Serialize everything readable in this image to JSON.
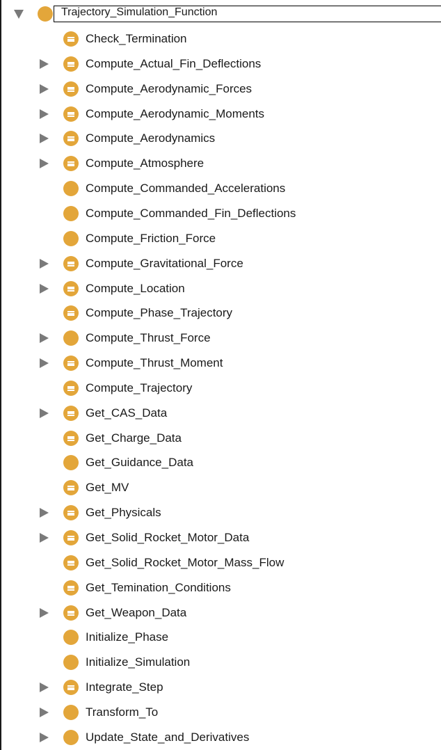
{
  "root": {
    "label": "Trajectory_Simulation_Function",
    "expanded": true,
    "icon": "class-circle-icon"
  },
  "items": [
    {
      "label": "Check_Termination",
      "expandable": false,
      "icon": "lines"
    },
    {
      "label": "Compute_Actual_Fin_Deflections",
      "expandable": true,
      "icon": "lines"
    },
    {
      "label": "Compute_Aerodynamic_Forces",
      "expandable": true,
      "icon": "lines"
    },
    {
      "label": "Compute_Aerodynamic_Moments",
      "expandable": true,
      "icon": "lines"
    },
    {
      "label": "Compute_Aerodynamics",
      "expandable": true,
      "icon": "lines"
    },
    {
      "label": "Compute_Atmosphere",
      "expandable": true,
      "icon": "lines"
    },
    {
      "label": "Compute_Commanded_Accelerations",
      "expandable": false,
      "icon": "plain"
    },
    {
      "label": "Compute_Commanded_Fin_Deflections",
      "expandable": false,
      "icon": "plain"
    },
    {
      "label": "Compute_Friction_Force",
      "expandable": false,
      "icon": "plain"
    },
    {
      "label": "Compute_Gravitational_Force",
      "expandable": true,
      "icon": "lines"
    },
    {
      "label": "Compute_Location",
      "expandable": true,
      "icon": "lines"
    },
    {
      "label": "Compute_Phase_Trajectory",
      "expandable": false,
      "icon": "lines"
    },
    {
      "label": "Compute_Thrust_Force",
      "expandable": true,
      "icon": "plain"
    },
    {
      "label": "Compute_Thrust_Moment",
      "expandable": true,
      "icon": "lines"
    },
    {
      "label": "Compute_Trajectory",
      "expandable": false,
      "icon": "lines"
    },
    {
      "label": "Get_CAS_Data",
      "expandable": true,
      "icon": "lines"
    },
    {
      "label": "Get_Charge_Data",
      "expandable": false,
      "icon": "lines"
    },
    {
      "label": "Get_Guidance_Data",
      "expandable": false,
      "icon": "plain"
    },
    {
      "label": "Get_MV",
      "expandable": false,
      "icon": "lines"
    },
    {
      "label": "Get_Physicals",
      "expandable": true,
      "icon": "lines"
    },
    {
      "label": "Get_Solid_Rocket_Motor_Data",
      "expandable": true,
      "icon": "lines"
    },
    {
      "label": "Get_Solid_Rocket_Motor_Mass_Flow",
      "expandable": false,
      "icon": "lines"
    },
    {
      "label": "Get_Temination_Conditions",
      "expandable": false,
      "icon": "lines"
    },
    {
      "label": "Get_Weapon_Data",
      "expandable": true,
      "icon": "lines"
    },
    {
      "label": "Initialize_Phase",
      "expandable": false,
      "icon": "plain"
    },
    {
      "label": "Initialize_Simulation",
      "expandable": false,
      "icon": "plain"
    },
    {
      "label": "Integrate_Step",
      "expandable": true,
      "icon": "lines"
    },
    {
      "label": "Transform_To",
      "expandable": true,
      "icon": "plain"
    },
    {
      "label": "Update_State_and_Derivatives",
      "expandable": true,
      "icon": "plain"
    }
  ],
  "colors": {
    "class_icon": "#e3a63a",
    "toggle": "#7a7a7a",
    "text": "#1a1a1a"
  }
}
